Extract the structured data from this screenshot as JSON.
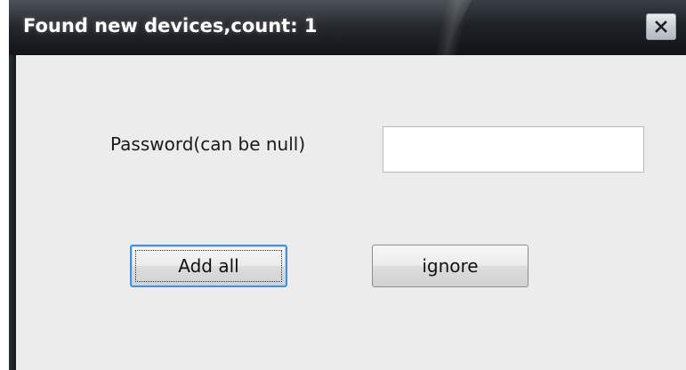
{
  "window": {
    "title": "Found new devices,count: 1",
    "close_icon": "close-icon"
  },
  "form": {
    "password_label": "Password(can be null)",
    "password_value": "",
    "password_placeholder": ""
  },
  "buttons": {
    "add_all_label": "Add all",
    "ignore_label": "ignore"
  },
  "colors": {
    "titlebar": "#1e2227",
    "client_background": "#ececec",
    "focus_border": "#4a8fd4"
  }
}
